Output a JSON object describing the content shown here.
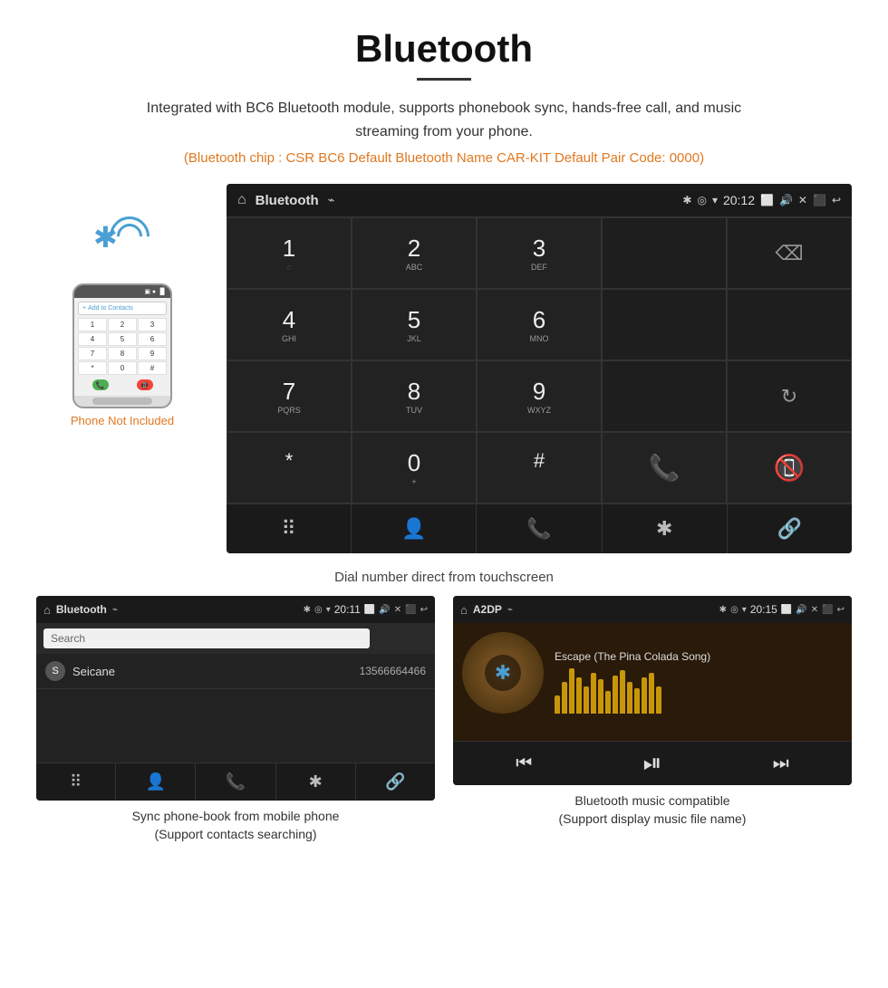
{
  "page": {
    "title": "Bluetooth",
    "title_underline": true,
    "subtitle": "Integrated with BC6 Bluetooth module, supports phonebook sync, hands-free call, and music streaming from your phone.",
    "info_line": "(Bluetooth chip : CSR BC6    Default Bluetooth Name CAR-KIT    Default Pair Code: 0000)",
    "phone_not_included": "Phone Not Included",
    "dial_caption": "Dial number direct from touchscreen"
  },
  "car_display": {
    "app_title": "Bluetooth",
    "time": "20:12",
    "usb_symbol": "⌁",
    "dialpad": [
      {
        "number": "1",
        "letters": "◌"
      },
      {
        "number": "2",
        "letters": "ABC"
      },
      {
        "number": "3",
        "letters": "DEF"
      },
      {
        "number": "4",
        "letters": "GHI"
      },
      {
        "number": "5",
        "letters": "JKL"
      },
      {
        "number": "6",
        "letters": "MNO"
      },
      {
        "number": "7",
        "letters": "PQRS"
      },
      {
        "number": "8",
        "letters": "TUV"
      },
      {
        "number": "9",
        "letters": "WXYZ"
      },
      {
        "number": "*",
        "letters": ""
      },
      {
        "number": "0",
        "letters": "+"
      },
      {
        "number": "#",
        "letters": ""
      }
    ],
    "bottom_nav": [
      "⠿",
      "👤",
      "📞",
      "✱",
      "🔗"
    ]
  },
  "phonebook_screen": {
    "app_title": "Bluetooth",
    "time": "20:11",
    "search_placeholder": "Search",
    "contact": {
      "letter": "S",
      "name": "Seicane",
      "number": "13566664466"
    },
    "caption_line1": "Sync phone-book from mobile phone",
    "caption_line2": "(Support contacts searching)"
  },
  "music_screen": {
    "app_title": "A2DP",
    "time": "20:15",
    "song_title": "Escape (The Pina Colada Song)",
    "eq_bars": [
      20,
      35,
      50,
      40,
      30,
      45,
      38,
      25,
      42,
      48,
      35,
      28,
      40,
      45,
      30
    ],
    "caption_line1": "Bluetooth music compatible",
    "caption_line2": "(Support display music file name)"
  }
}
